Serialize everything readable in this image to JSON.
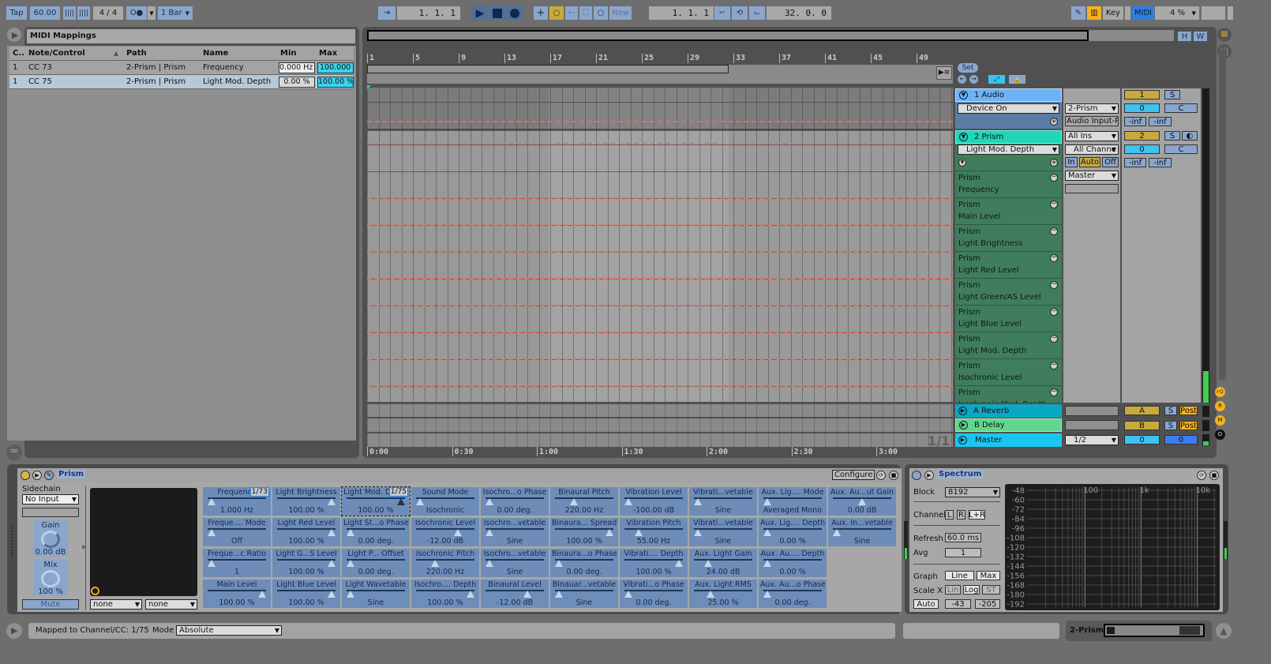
{
  "transport": {
    "tap": "Tap",
    "tempo": "60.00",
    "signature": "4 / 4",
    "metronome": "O●",
    "quantize": "1 Bar",
    "arrangement_position": "1.  1.  1",
    "new_label": "New",
    "loop_start": "1.  1.  1",
    "loop_length": "32.  0.  0",
    "key_label": "Key",
    "midi_label": "MIDI",
    "cpu": "4 %"
  },
  "browser": {
    "title": "MIDI Mappings",
    "columns": [
      "C..",
      "Note/Control",
      "Path",
      "Name",
      "Min",
      "Max"
    ],
    "rows": [
      {
        "ch": "1",
        "control": "CC 73",
        "path": "2-Prism | Prism",
        "name": "Frequency",
        "min": "0.000 Hz",
        "max": "100.000 H",
        "selected": false
      },
      {
        "ch": "1",
        "control": "CC 75",
        "path": "2-Prism | Prism",
        "name": "Light Mod. Depth",
        "min": "0.00 %",
        "max": "100.00 %",
        "selected": true
      }
    ]
  },
  "arrangement": {
    "ruler_bars": [
      "1",
      "5",
      "9",
      "13",
      "17",
      "21",
      "25",
      "29",
      "33",
      "37",
      "41",
      "45",
      "49"
    ],
    "time_ticks": [
      "0:00",
      "0:30",
      "1:00",
      "1:30",
      "2:00",
      "2:30",
      "3:00"
    ],
    "zoom_buttons": [
      "H",
      "W"
    ],
    "set_label": "Set",
    "page_indicator": "1/1",
    "tracks": [
      {
        "name": "1 Audio",
        "envelope": "Device On",
        "input": "2-Prism",
        "input_channel": "Audio Input-P",
        "number": "1",
        "volume": "0",
        "pan": "C",
        "peak_l": "-inf",
        "peak_r": "-inf",
        "solo": "S",
        "color": "#6cb2f5"
      },
      {
        "name": "2 Prism",
        "envelope": "Light Mod. Depth",
        "input": "All Ins",
        "input_channel": "All Channe",
        "monitor": [
          "In",
          "Auto",
          "Off"
        ],
        "output": "Master",
        "number": "2",
        "volume": "0",
        "pan": "C",
        "peak_l": "-inf",
        "peak_r": "-inf",
        "solo": "S",
        "color": "#20d6b8"
      }
    ],
    "envelope_lanes": [
      {
        "device": "Prism",
        "param": "Frequency"
      },
      {
        "device": "Prism",
        "param": "Main Level"
      },
      {
        "device": "Prism",
        "param": "Light Brightness"
      },
      {
        "device": "Prism",
        "param": "Light Red Level"
      },
      {
        "device": "Prism",
        "param": "Light Green/AS Level"
      },
      {
        "device": "Prism",
        "param": "Light Blue Level"
      },
      {
        "device": "Prism",
        "param": "Light Mod. Depth"
      },
      {
        "device": "Prism",
        "param": "Isochronic Level"
      },
      {
        "device": "Prism",
        "param": "Isochronic Mod. Depth"
      }
    ],
    "returns": [
      {
        "name": "A Reverb",
        "letter": "A",
        "solo": "S",
        "post": "Post",
        "color": "#0aa8c4"
      },
      {
        "name": "B Delay",
        "letter": "B",
        "solo": "S",
        "post": "Post",
        "color": "#62d690"
      }
    ],
    "master": {
      "name": "Master",
      "cue_out": "1/2",
      "volume": "0",
      "cue": "0",
      "color": "#1ac6f0"
    },
    "side_buttons": [
      "I·O",
      "R",
      "M",
      "D"
    ]
  },
  "device_prism": {
    "title": "Prism",
    "configure": "Configure",
    "sidechain_label": "Sidechain",
    "sidechain_input": "No Input",
    "gain_label": "Gain",
    "gain_value": "0.00 dB",
    "mix_label": "Mix",
    "mix_value": "100 %",
    "mute": "Mute",
    "xy_x": "none",
    "xy_y": "none",
    "columns": [
      [
        {
          "name": "Frequency",
          "value": "1.000 Hz",
          "pos": 0,
          "mapping": "1/73"
        },
        {
          "name": "Freque.... Mode",
          "value": "Off",
          "pos": 0
        },
        {
          "name": "Freque...c Ratio",
          "value": "1",
          "pos": 0
        },
        {
          "name": "Main Level",
          "value": "100.00 %",
          "pos": 1
        }
      ],
      [
        {
          "name": "Light Brightness",
          "value": "100.00 %",
          "pos": 1
        },
        {
          "name": "Light Red Level",
          "value": "100.00 %",
          "pos": 1
        },
        {
          "name": "Light G...S Level",
          "value": "100.00 %",
          "pos": 1
        },
        {
          "name": "Light Blue Level",
          "value": "100.00 %",
          "pos": 1
        }
      ],
      [
        {
          "name": "Light Mod. Depth",
          "value": "100.00 %",
          "pos": 1,
          "mapping": "1/75",
          "selected": true
        },
        {
          "name": "Light St...o Phase",
          "value": "0.00 deg.",
          "pos": 0
        },
        {
          "name": "Light P... Offset",
          "value": "0.00 deg.",
          "pos": 0
        },
        {
          "name": "Light Wavetable",
          "value": "Sine",
          "pos": 0
        }
      ],
      [
        {
          "name": "Sound Mode",
          "value": "Isochronic",
          "pos": 0
        },
        {
          "name": "Isochronic Level",
          "value": "-12.00 dB",
          "pos": 0.75
        },
        {
          "name": "Isochronic Pitch",
          "value": "220.00 Hz",
          "pos": 0.3
        },
        {
          "name": "Isochro.... Depth",
          "value": "100.00 %",
          "pos": 1
        }
      ],
      [
        {
          "name": "Isochro...o Phase",
          "value": "0.00 deg.",
          "pos": 0
        },
        {
          "name": "Isochro...vetable",
          "value": "Sine",
          "pos": 0
        },
        {
          "name": "Isochro...vetable",
          "value": "Sine",
          "pos": 0
        },
        {
          "name": "Binaural Level",
          "value": "-12.00 dB",
          "pos": 0.75
        }
      ],
      [
        {
          "name": "Binaural Pitch",
          "value": "220.00 Hz",
          "pos": 0.3
        },
        {
          "name": "Binaura... Spread",
          "value": "100.00 %",
          "pos": 1
        },
        {
          "name": "Binaura...o Phase",
          "value": "0.00 deg.",
          "pos": 0
        },
        {
          "name": "Binauar...vetable",
          "value": "Sine",
          "pos": 0
        }
      ],
      [
        {
          "name": "Vibration Level",
          "value": "-100.00 dB",
          "pos": 0
        },
        {
          "name": "Vibration Pitch",
          "value": "55.00 Hz",
          "pos": 0.2
        },
        {
          "name": "Vibrati.... Depth",
          "value": "100.00 %",
          "pos": 1
        },
        {
          "name": "Vibrati...o Phase",
          "value": "0.00 deg.",
          "pos": 0
        }
      ],
      [
        {
          "name": "Vibrati...vetable",
          "value": "Sine",
          "pos": 0
        },
        {
          "name": "Vibrati...vetable",
          "value": "Sine",
          "pos": 0
        },
        {
          "name": "Aux. Light Gain",
          "value": "24.00 dB",
          "pos": 0.2
        },
        {
          "name": "Aux. Light RMS",
          "value": "25.00 %",
          "pos": 0.25
        }
      ],
      [
        {
          "name": "Aux. Lig.... Mode",
          "value": "Averaged Mono",
          "pos": 0
        },
        {
          "name": "Aux. Lig.... Depth",
          "value": "0.00 %",
          "pos": 0
        },
        {
          "name": "Aux. Au.... Depth",
          "value": "0.00 %",
          "pos": 0
        },
        {
          "name": "Aux. Au...o Phase",
          "value": "0.00 deg.",
          "pos": 0
        }
      ],
      [
        {
          "name": "Aux. Au...ut Gain",
          "value": "0.00 dB",
          "pos": 0.5
        },
        {
          "name": "Aux. In...vetable",
          "value": "Sine",
          "pos": 0
        }
      ]
    ]
  },
  "device_spectrum": {
    "title": "Spectrum",
    "block_label": "Block",
    "block_value": "8192",
    "channel_label": "Channel",
    "channel_options": [
      "L",
      "R",
      "L+R"
    ],
    "refresh_label": "Refresh",
    "refresh_value": "60.0 ms",
    "avg_label": "Avg",
    "avg_value": "1",
    "graph_label": "Graph",
    "graph_options": [
      "Line",
      "Max"
    ],
    "scale_label": "Scale X",
    "scale_options": [
      "Lin",
      "Log",
      "ST"
    ],
    "auto_label": "Auto",
    "range_hi": "-43",
    "range_lo": "-205",
    "db_ticks": [
      "-48",
      "-60",
      "-72",
      "-84",
      "-96",
      "-108",
      "-120",
      "-132",
      "-144",
      "-156",
      "-168",
      "-180",
      "-192"
    ],
    "freq_ticks": [
      "100",
      "1k",
      "10k"
    ]
  },
  "status_bar": {
    "mapping_text": "Mapped to Channel/CC:  1/75",
    "mode_label": "Mode",
    "mode_value": "Absolute",
    "track_name": "2-Prism"
  }
}
